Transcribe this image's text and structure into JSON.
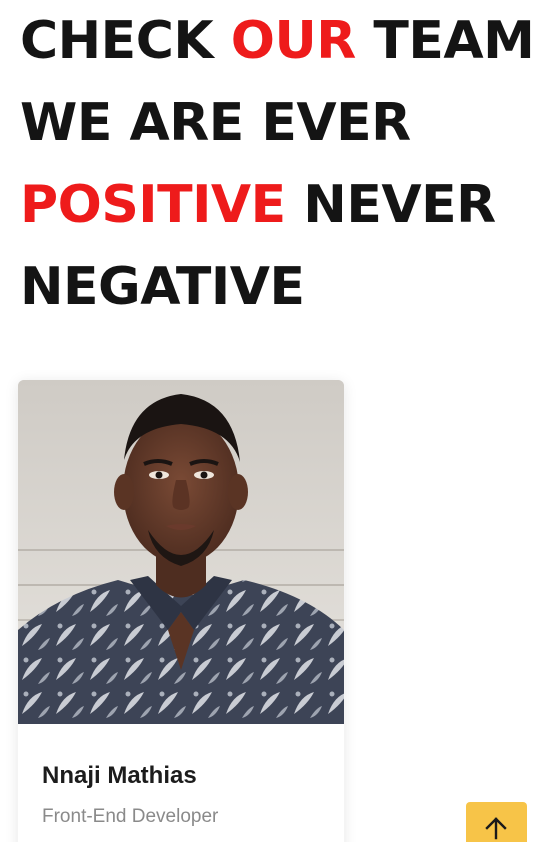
{
  "headline": {
    "line1": {
      "part1": "CHECK ",
      "accent": "OUR",
      "part2": " TEAM"
    },
    "line2": "WE ARE EVER",
    "line3": {
      "accent": "POSITIVE",
      "part2": " NEVER"
    },
    "line4": "NEGATIVE"
  },
  "colors": {
    "accent": "#ee1b1b",
    "text": "#141414",
    "back_to_top": "#f7c448"
  },
  "team": [
    {
      "name": "Nnaji Mathias",
      "role": "Front-End Developer",
      "photo_icon": "portrait-photo"
    }
  ],
  "back_to_top": {
    "icon": "arrow-up-icon"
  }
}
